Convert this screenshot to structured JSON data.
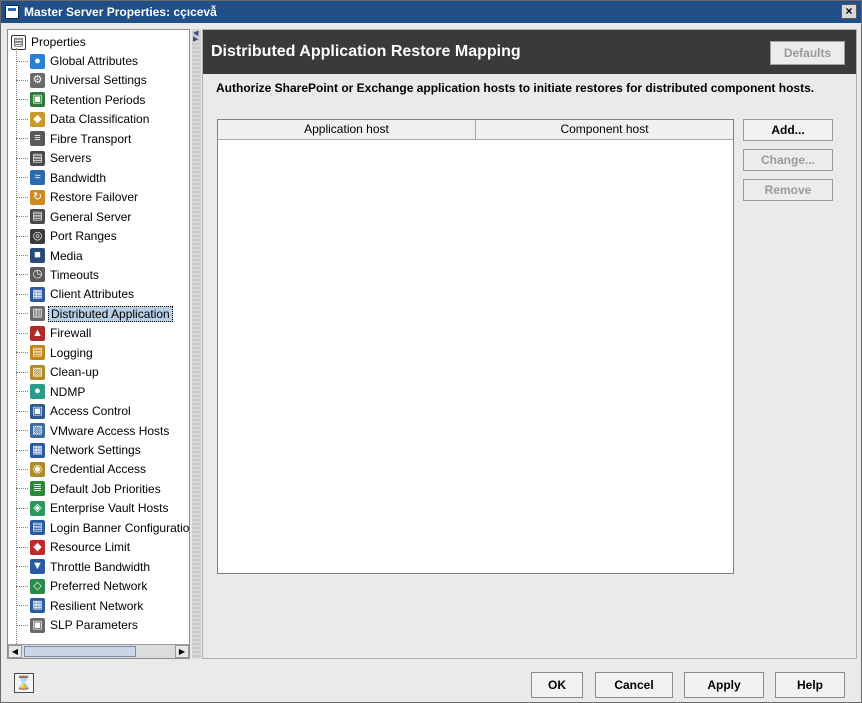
{
  "window": {
    "title": "Master Server Properties: cçıcevẫ",
    "close_label": "×"
  },
  "tree": {
    "root_label": "Properties",
    "items": [
      {
        "label": "Global Attributes",
        "icon": "globe-icon",
        "color": "#2a7fd4"
      },
      {
        "label": "Universal Settings",
        "icon": "settings-icon",
        "color": "#6a6a6a"
      },
      {
        "label": "Retention Periods",
        "icon": "retention-icon",
        "color": "#2f7a3a"
      },
      {
        "label": "Data Classification",
        "icon": "classification-icon",
        "color": "#c89a2a"
      },
      {
        "label": "Fibre Transport",
        "icon": "fibre-icon",
        "color": "#5a5a5a"
      },
      {
        "label": "Servers",
        "icon": "server-icon",
        "color": "#4a4a4a"
      },
      {
        "label": "Bandwidth",
        "icon": "bandwidth-icon",
        "color": "#2a6ab0"
      },
      {
        "label": "Restore Failover",
        "icon": "failover-icon",
        "color": "#d08a20"
      },
      {
        "label": "General Server",
        "icon": "server-icon",
        "color": "#4a4a4a"
      },
      {
        "label": "Port Ranges",
        "icon": "port-icon",
        "color": "#3a3a3a"
      },
      {
        "label": "Media",
        "icon": "media-icon",
        "color": "#2a4a7a"
      },
      {
        "label": "Timeouts",
        "icon": "clock-icon",
        "color": "#5a5a5a"
      },
      {
        "label": "Client Attributes",
        "icon": "client-icon",
        "color": "#2a5aa0"
      },
      {
        "label": "Distributed Application",
        "icon": "distributed-icon",
        "color": "#6a6a6a"
      },
      {
        "label": "Firewall",
        "icon": "firewall-icon",
        "color": "#b02a2a"
      },
      {
        "label": "Logging",
        "icon": "logging-icon",
        "color": "#c0861a"
      },
      {
        "label": "Clean-up",
        "icon": "cleanup-icon",
        "color": "#b08a2a"
      },
      {
        "label": "NDMP",
        "icon": "ndmp-icon",
        "color": "#2a9a8a"
      },
      {
        "label": "Access Control",
        "icon": "access-icon",
        "color": "#2a5a90"
      },
      {
        "label": "VMware Access Hosts",
        "icon": "vmware-icon",
        "color": "#3a6aa0"
      },
      {
        "label": "Network Settings",
        "icon": "network-icon",
        "color": "#2a5aa0"
      },
      {
        "label": "Credential Access",
        "icon": "credential-icon",
        "color": "#b08a2a"
      },
      {
        "label": "Default Job Priorities",
        "icon": "priority-icon",
        "color": "#2a8a3a"
      },
      {
        "label": "Enterprise Vault Hosts",
        "icon": "vault-icon",
        "color": "#2a9a5a"
      },
      {
        "label": "Login Banner Configuration",
        "icon": "banner-icon",
        "color": "#2a5aa0"
      },
      {
        "label": "Resource Limit",
        "icon": "resource-icon",
        "color": "#c02a2a"
      },
      {
        "label": "Throttle Bandwidth",
        "icon": "throttle-icon",
        "color": "#2a5aa0"
      },
      {
        "label": "Preferred Network",
        "icon": "preferred-network-icon",
        "color": "#2a8a4a"
      },
      {
        "label": "Resilient Network",
        "icon": "resilient-network-icon",
        "color": "#2a5aa0"
      },
      {
        "label": "SLP Parameters",
        "icon": "slp-icon",
        "color": "#6a6a6a"
      }
    ]
  },
  "panel": {
    "title": "Distributed Application Restore Mapping",
    "defaults_label": "Defaults",
    "description": "Authorize SharePoint or Exchange application hosts to initiate restores for distributed component hosts.",
    "columns": [
      "Application host",
      "Component host"
    ],
    "buttons": {
      "add": "Add...",
      "change": "Change...",
      "remove": "Remove"
    }
  },
  "footer": {
    "ok": "OK",
    "cancel": "Cancel",
    "apply": "Apply",
    "help": "Help"
  }
}
